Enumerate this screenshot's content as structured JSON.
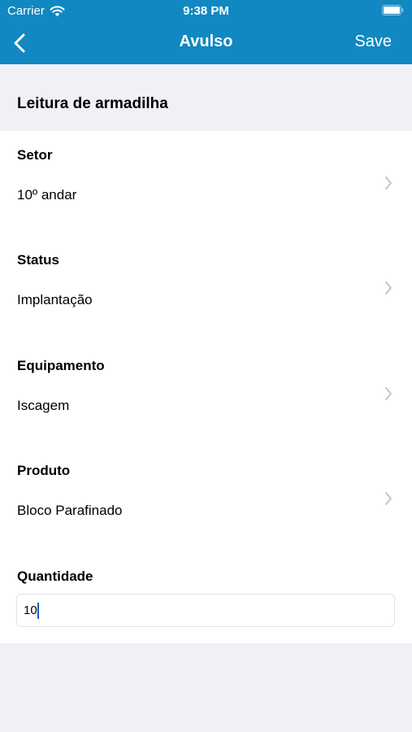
{
  "status_bar": {
    "carrier": "Carrier",
    "time": "9:38 PM"
  },
  "navbar": {
    "title": "Avulso",
    "save_label": "Save",
    "back_icon": "chevron-left-icon"
  },
  "section": {
    "title": "Leitura de armadilha"
  },
  "form": {
    "rows": [
      {
        "label": "Setor",
        "value": "10º andar"
      },
      {
        "label": "Status",
        "value": "Implantação"
      },
      {
        "label": "Equipamento",
        "value": "Iscagem"
      },
      {
        "label": "Produto",
        "value": "Bloco Parafinado"
      }
    ],
    "quantity": {
      "label": "Quantidade",
      "value": "10"
    }
  },
  "colors": {
    "accent": "#1188c1",
    "background": "#f1f1f5",
    "caret": "#1a5bd6"
  }
}
